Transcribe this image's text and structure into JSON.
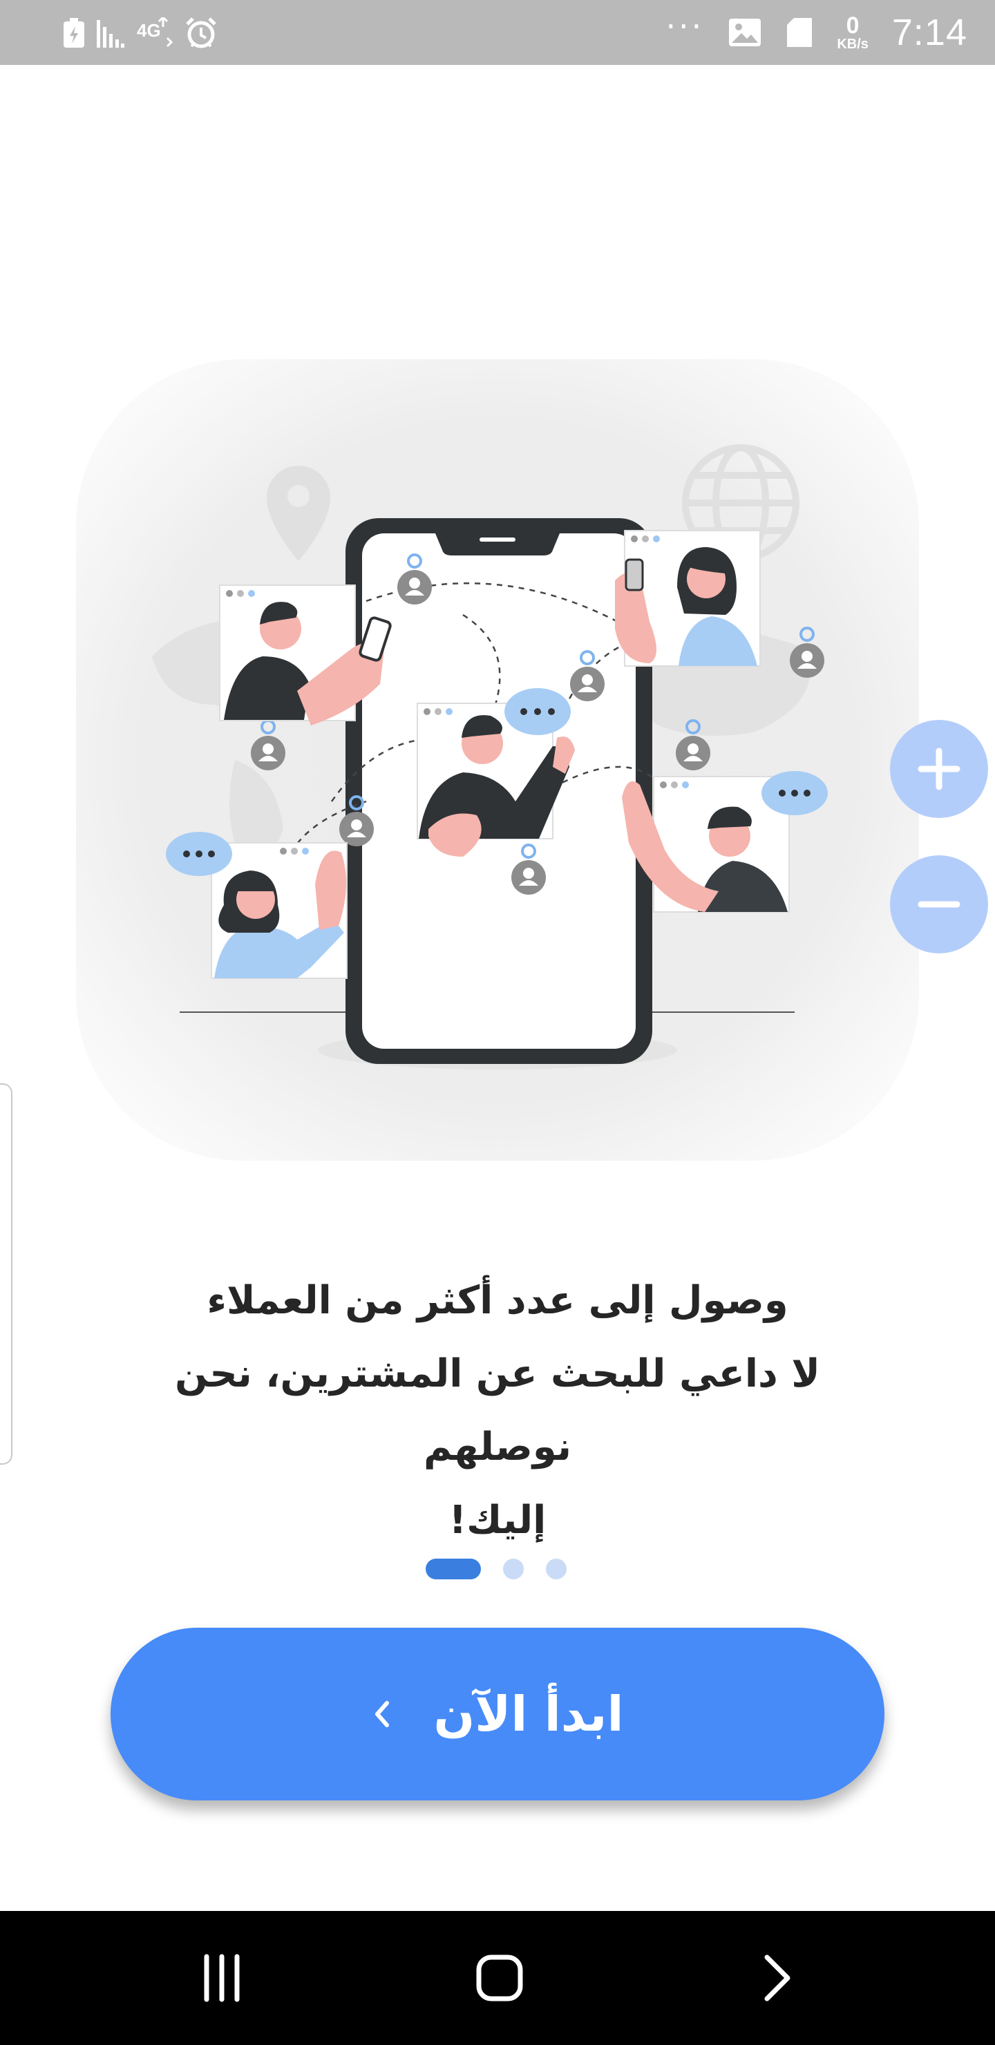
{
  "status_bar": {
    "time": "7:14",
    "net_speed_value": "0",
    "net_speed_unit": "KB/s",
    "overflow": "···",
    "icons": [
      "battery-saver-icon",
      "signal-icon",
      "4g-icon",
      "alarm-icon",
      "image-notification-icon",
      "sd-card-icon"
    ]
  },
  "onboarding": {
    "title": "وصول إلى عدد أكثر من العملاء",
    "subtitle_line1": "لا داعي للبحث عن المشترين، نحن نوصلهم",
    "subtitle_line2": "إليك!",
    "page_count": 3,
    "active_page": 1
  },
  "zoom": {
    "in_icon": "plus-icon",
    "out_icon": "minus-icon"
  },
  "cta": {
    "label": "ابدأ الآن",
    "icon": "chevron-left-icon"
  },
  "nav_bar": {
    "icons": [
      "recents-icon",
      "home-icon",
      "back-icon"
    ]
  },
  "colors": {
    "primary": "#478bf8",
    "indicator_active": "#3a7fe0",
    "indicator_inactive": "#c9dbf6",
    "zoom_button": "#b3cdfb",
    "status_bar": "#b9b9b9"
  }
}
